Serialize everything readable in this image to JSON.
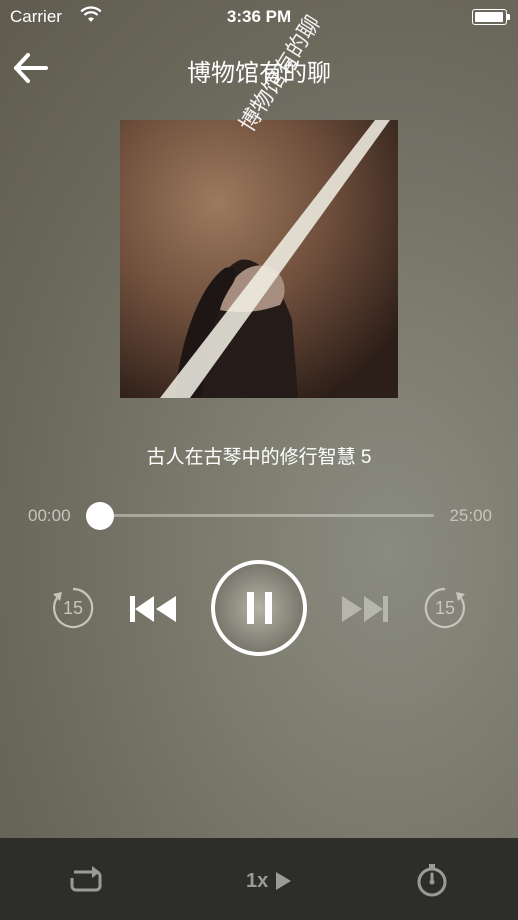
{
  "status_bar": {
    "carrier": "Carrier",
    "time": "3:36 PM"
  },
  "header": {
    "title": "博物馆有的聊"
  },
  "artwork": {
    "overlay_text": "博物馆有的聊"
  },
  "track": {
    "title": "古人在古琴中的修行智慧 5"
  },
  "progress": {
    "current": "00:00",
    "total": "25:00",
    "fraction": 0.04
  },
  "controls": {
    "rewind_seconds": "15",
    "forward_seconds": "15"
  },
  "bottom_bar": {
    "speed": "1x"
  }
}
